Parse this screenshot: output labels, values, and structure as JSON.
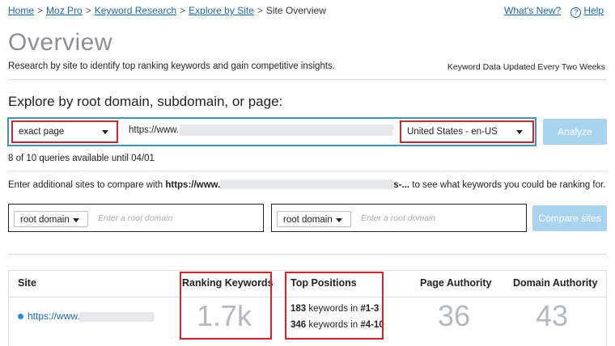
{
  "breadcrumb": {
    "items": [
      "Home",
      "Moz Pro",
      "Keyword Research",
      "Explore by Site"
    ],
    "current": "Site Overview",
    "separator": ">"
  },
  "top_links": {
    "whats_new": "What's New?",
    "help": "Help"
  },
  "page": {
    "title": "Overview",
    "subtitle": "Research by site to identify top ranking keywords and gain competitive insights.",
    "update_note": "Keyword Data Updated Every Two Weeks"
  },
  "explore": {
    "heading": "Explore by root domain, subdomain, or page:",
    "scope_select": "exact page",
    "url_value": "https://www.",
    "locale_select": "United States - en-US",
    "analyze_label": "Analyze",
    "queries_note": "8 of 10 queries available until 04/01"
  },
  "compare": {
    "prefix": "Enter additional sites to compare with",
    "url_start": "https://www.",
    "url_end": "s-...",
    "suffix": "to see what keywords you could be ranking for.",
    "select1": "root domain",
    "placeholder1": "Enter a root domain",
    "select2": "root domain",
    "placeholder2": "Enter a root domain",
    "button_label": "Compare sites"
  },
  "metrics": {
    "headers": {
      "site": "Site",
      "ranking_keywords": "Ranking Keywords",
      "top_positions": "Top Positions",
      "page_authority": "Page Authority",
      "domain_authority": "Domain Authority"
    },
    "site_url": "https://www.",
    "ranking_keywords": "1.7k",
    "top_positions": [
      {
        "count": "183",
        "text": "keywords in",
        "range": "#1-3"
      },
      {
        "count": "346",
        "text": "keywords in",
        "range": "#4-10"
      }
    ],
    "page_authority": "36",
    "domain_authority": "43"
  },
  "colors": {
    "link": "#1a66b3",
    "highlight_red": "#d6232b",
    "highlight_blue": "#3a93c9",
    "button_disabled": "#a9d4f0",
    "site_dot": "#2a8ee0"
  }
}
